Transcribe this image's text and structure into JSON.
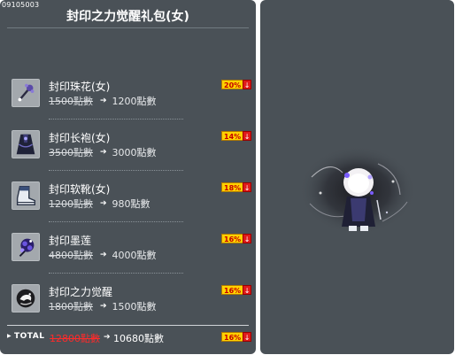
{
  "package": {
    "id": "09105003",
    "title": "封印之力觉醒礼包(女)"
  },
  "items": [
    {
      "name": "封印珠花(女)",
      "old_price": "1500點數",
      "new_price": "1200點數",
      "discount": "20%",
      "icon": "hairpin-icon"
    },
    {
      "name": "封印长袍(女)",
      "old_price": "3500點數",
      "new_price": "3000點數",
      "discount": "14%",
      "icon": "robe-icon"
    },
    {
      "name": "封印软靴(女)",
      "old_price": "1200點數",
      "new_price": "980點數",
      "discount": "18%",
      "icon": "boots-icon"
    },
    {
      "name": "封印墨莲",
      "old_price": "4800點數",
      "new_price": "4000點數",
      "discount": "16%",
      "icon": "lotus-icon"
    },
    {
      "name": "封印之力觉醒",
      "old_price": "1800點數",
      "new_price": "1500點數",
      "discount": "16%",
      "icon": "awakening-icon"
    }
  ],
  "total": {
    "label": "TOTAL",
    "old_price": "12800點數",
    "new_price": "10680點數",
    "discount": "16%"
  },
  "badge": {
    "arrow": "↓"
  },
  "colors": {
    "panel_bg": "#4a5157",
    "badge_yellow": "#ffd200",
    "badge_red": "#e01a1a",
    "total_old_red": "#ff2a2a"
  },
  "preview": {
    "icon": "character-preview-icon"
  }
}
